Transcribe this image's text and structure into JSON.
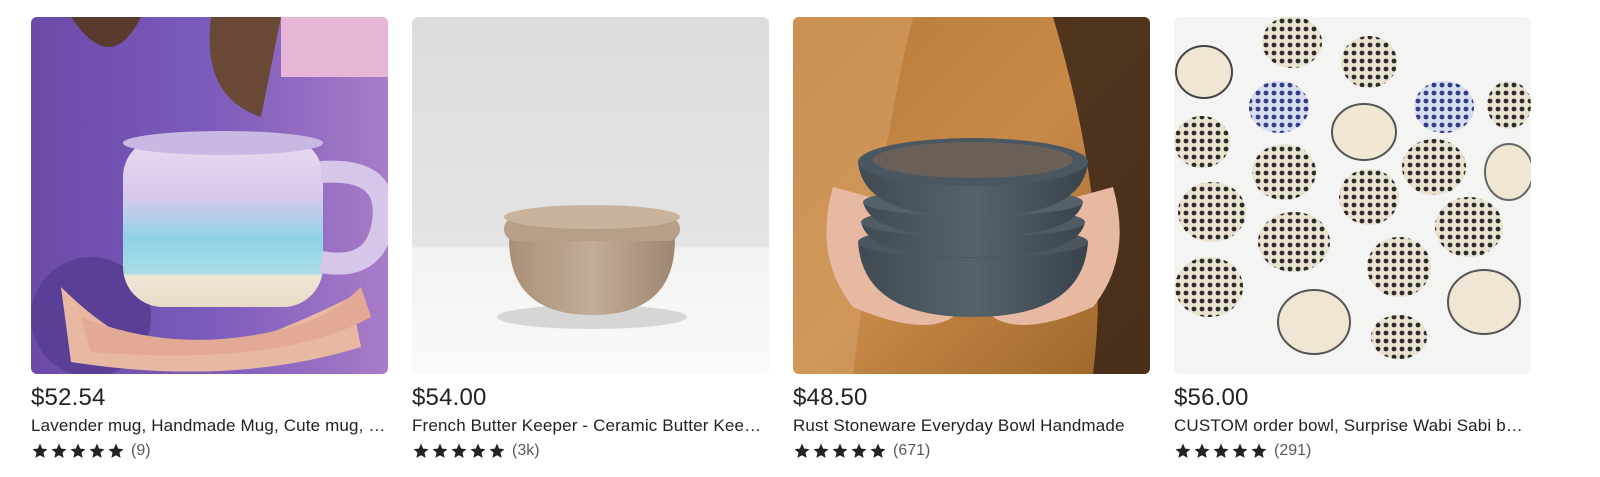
{
  "listings": [
    {
      "price": "$52.54",
      "title": "Lavender mug, Handmade Mug, Cute mug, Ceramic Mug",
      "review_count": "(9)",
      "rating_stars": 5,
      "image": "lavender-mug-photo"
    },
    {
      "price": "$54.00",
      "title": "French Butter Keeper - Ceramic Butter Keeper",
      "review_count": "(3k)",
      "rating_stars": 5,
      "image": "butter-keeper-photo"
    },
    {
      "price": "$48.50",
      "title": "Rust Stoneware Everyday Bowl Handmade",
      "review_count": "(671)",
      "rating_stars": 5,
      "image": "stoneware-bowls-photo"
    },
    {
      "price": "$56.00",
      "title": "CUSTOM order bowl, Surprise Wabi Sabi bowl",
      "review_count": "(291)",
      "rating_stars": 5,
      "image": "dotted-bowls-photo"
    }
  ],
  "colors": {
    "text": "#222222",
    "muted": "#595959",
    "star": "#222222"
  }
}
